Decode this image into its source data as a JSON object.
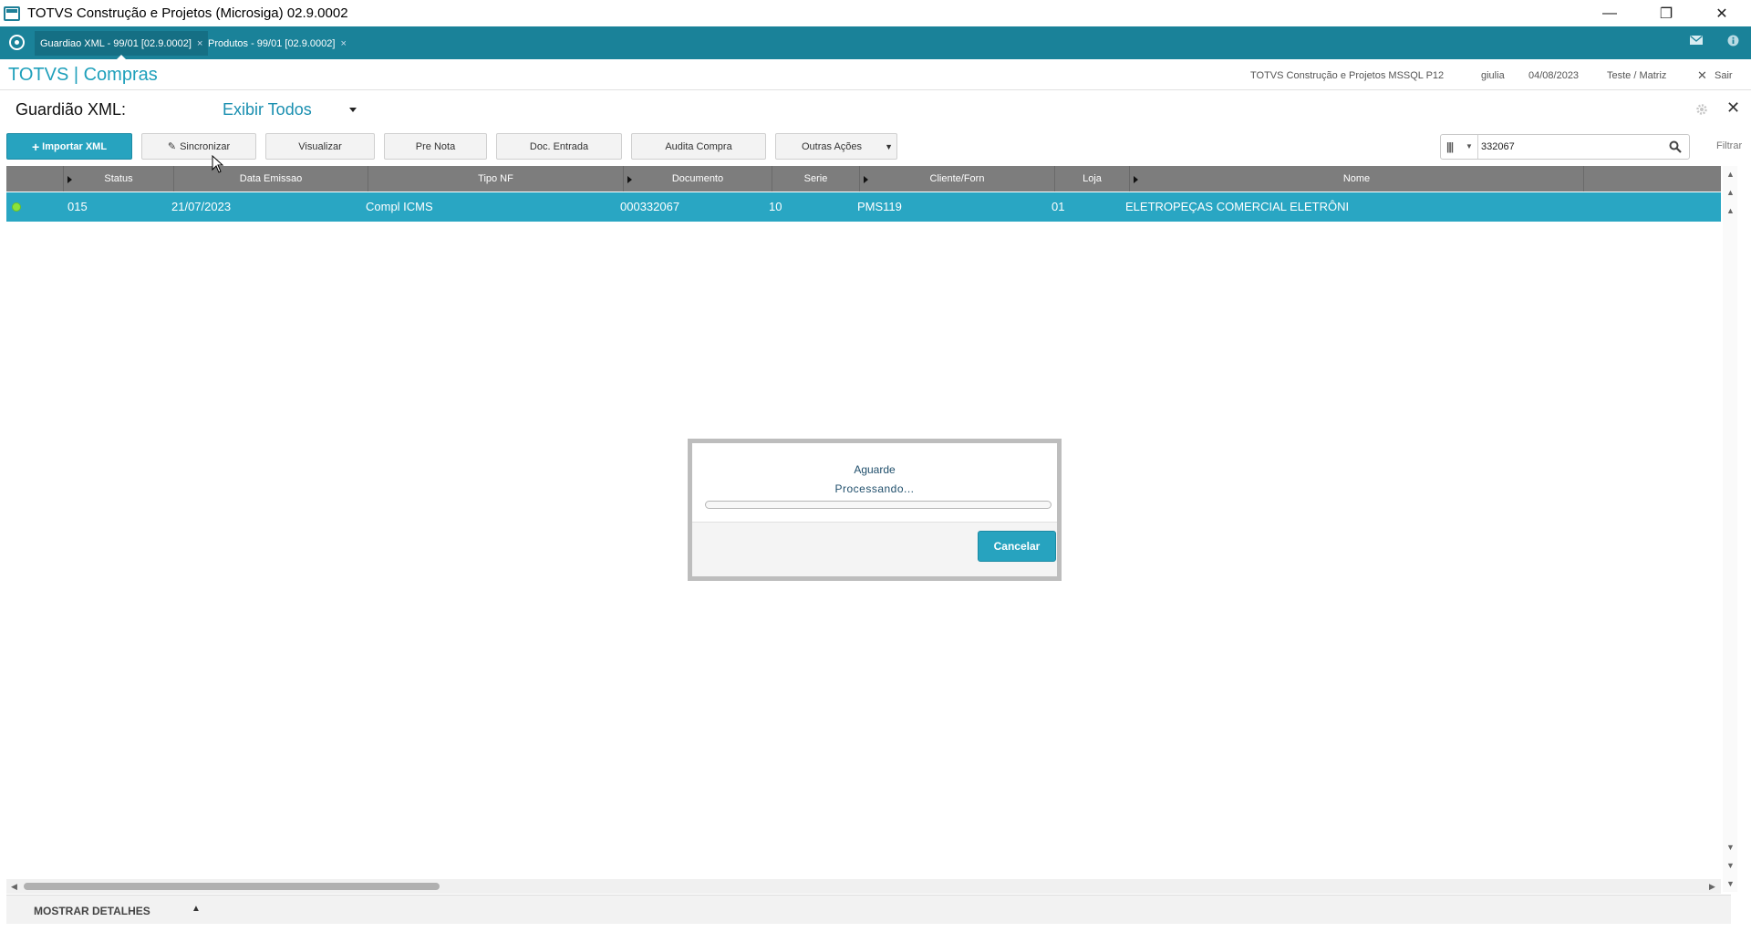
{
  "window": {
    "title": "TOTVS Construção e Projetos (Microsiga) 02.9.0002",
    "minimize": "—",
    "restore": "❐",
    "close": "✕"
  },
  "tabs": [
    {
      "label": "Guardiao XML - 99/01 [02.9.0002]",
      "close": "×",
      "active": true
    },
    {
      "label": "Produtos - 99/01 [02.9.0002]",
      "close": "×",
      "active": false
    }
  ],
  "header": {
    "brand": "TOTVS | Compras",
    "company": "TOTVS Construção e Projetos MSSQL P12",
    "user": "giulia",
    "date": "04/08/2023",
    "branch": "Teste / Matriz",
    "logout": "Sair",
    "logout_icon": "✕"
  },
  "page": {
    "title": "Guardião XML:",
    "filter": "Exibir Todos",
    "close_icon": "✕"
  },
  "toolbar": {
    "import": "Importar XML",
    "import_icon": "+",
    "sync": "Sincronizar",
    "sync_icon": "✎",
    "view": "Visualizar",
    "pre_nota": "Pre Nota",
    "doc_entrada": "Doc. Entrada",
    "audita": "Audita Compra",
    "outras": "Outras Ações",
    "outras_caret": "▼"
  },
  "search": {
    "value": "332067",
    "view_icon": "|||",
    "caret": "▼",
    "filter_label": "Filtrar"
  },
  "grid": {
    "columns": [
      "Status",
      "Data Emissao",
      "Tipo NF",
      "Documento",
      "Serie",
      "Cliente/Forn",
      "Loja",
      "Nome"
    ],
    "rows": [
      {
        "status": "015",
        "data_emissao": "21/07/2023",
        "tipo_nf": "Compl ICMS",
        "documento": "000332067",
        "serie": "10",
        "cliente_forn": "PMS119",
        "loja": "01",
        "nome": "ELETROPEÇAS COMERCIAL ELETRÔNI"
      }
    ]
  },
  "footer": {
    "details": "MOSTRAR DETALHES",
    "toggle": "▲"
  },
  "dialog": {
    "wait": "Aguarde",
    "processing": "Processando...",
    "progress": 0,
    "cancel": "Cancelar"
  },
  "colors": {
    "accent": "#27a3bf",
    "tabbar": "#1a8299",
    "row_selected": "#29a6c3",
    "status_ok": "#8be23a"
  }
}
